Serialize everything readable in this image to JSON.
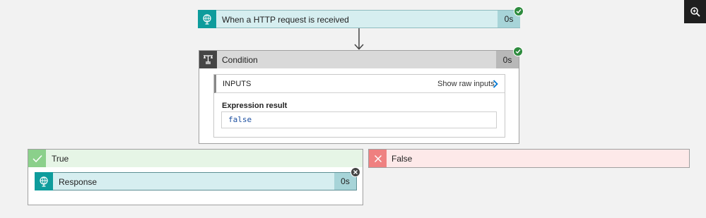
{
  "trigger": {
    "title": "When a HTTP request is received",
    "duration": "0s",
    "status": "succeeded",
    "icon": "http-request-icon"
  },
  "condition": {
    "title": "Condition",
    "duration": "0s",
    "status": "succeeded",
    "icon": "condition-icon",
    "inputs": {
      "header": "INPUTS",
      "show_raw_label": "Show raw inputs",
      "expression_label": "Expression result",
      "expression_value": "false"
    }
  },
  "branches": {
    "true_label": "True",
    "false_label": "False"
  },
  "response": {
    "title": "Response",
    "duration": "0s",
    "status": "skipped",
    "icon": "http-response-icon"
  },
  "toolbar": {
    "zoom_icon": "zoom-in-icon"
  },
  "colors": {
    "teal": "#0e9c9c",
    "teal_light": "#d6eef0",
    "teal_duration": "#a7d4d8",
    "condition_header": "#d9d9d9",
    "condition_icon_bg": "#454545",
    "success_green": "#2e8b3e",
    "true_branch_bg": "#e6f5e6",
    "true_branch_icon_bg": "#8bd08b",
    "false_branch_bg": "#fde9e9",
    "false_branch_icon_bg": "#ef8080"
  }
}
